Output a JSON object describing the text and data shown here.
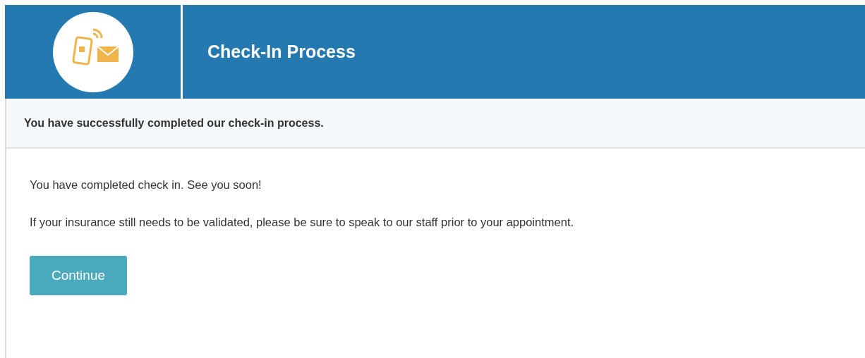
{
  "header": {
    "title": "Check-In Process"
  },
  "notice": "You have successfully completed our check-in process.",
  "paragraphs": [
    "You have completed check in. See you soon!",
    "If your insurance still needs to be validated, please be sure to speak to our staff prior to your appointment."
  ],
  "buttons": [
    "Continue"
  ]
}
